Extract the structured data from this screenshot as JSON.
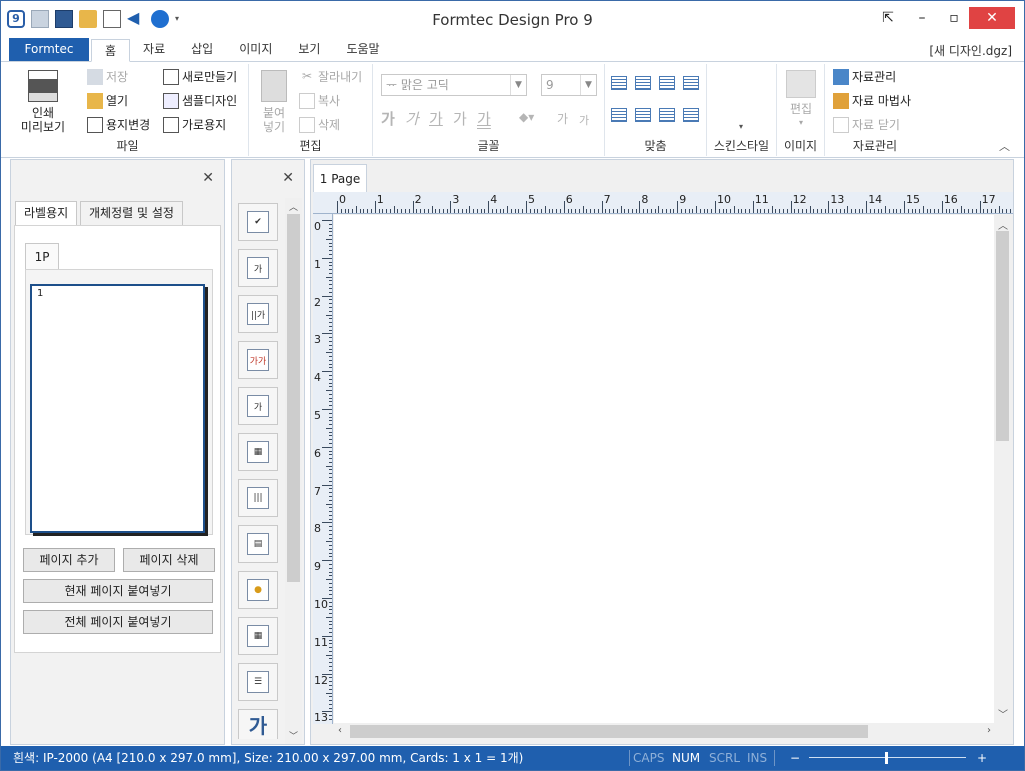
{
  "app": {
    "title": "Formtec Design Pro 9",
    "filename": "[새 디자인.dgz]"
  },
  "tabs": {
    "formtec": "Formtec",
    "items": [
      "홈",
      "자료",
      "삽입",
      "이미지",
      "보기",
      "도움말"
    ]
  },
  "ribbon": {
    "file": {
      "label": "파일",
      "print_preview": "인쇄\n미리보기",
      "save": "저장",
      "open": "열기",
      "paper_change": "용지변경",
      "new": "새로만들기",
      "sample_design": "샘플디자인",
      "landscape": "가로용지"
    },
    "edit": {
      "label": "편집",
      "paste": "붙여\n넣기",
      "cut": "잘라내기",
      "copy": "복사",
      "delete": "삭제"
    },
    "font": {
      "label": "글꼴",
      "font_name": "맑은 고딕",
      "font_size": "9"
    },
    "align": {
      "label": "맞춤"
    },
    "skin": {
      "label": "스킨스타일"
    },
    "image": {
      "label": "이미지",
      "edit": "편집"
    },
    "data": {
      "label": "자료관리",
      "manage": "자료관리",
      "wizard": "자료 마법사",
      "close": "자료 닫기"
    }
  },
  "left_panel": {
    "tabs": [
      "라벨용지",
      "개체정렬 및 설정"
    ],
    "page_tab": "1P",
    "thumb_number": "1",
    "add_page": "페이지 추가",
    "delete_page": "페이지 삭제",
    "paste_current": "현재 페이지 붙여넣기",
    "paste_all": "전체 페이지 붙여넣기"
  },
  "document": {
    "tab": "1 Page",
    "h_ruler": [
      "0",
      "1",
      "2",
      "3",
      "4",
      "5",
      "6",
      "7",
      "8",
      "9",
      "10",
      "11",
      "12",
      "13",
      "14",
      "15",
      "16",
      "17"
    ],
    "v_ruler": [
      "0",
      "1",
      "2",
      "3",
      "4",
      "5",
      "6",
      "7",
      "8",
      "9",
      "10",
      "11",
      "12",
      "13"
    ]
  },
  "status": {
    "info": "흰색: IP-2000 (A4 [210.0 x 297.0 mm], Size: 210.00 x 297.00 mm,  Cards: 1 x 1 = 1개)",
    "caps": "CAPS",
    "num": "NUM",
    "scrl": "SCRL",
    "ins": "INS",
    "zoom_minus": "−",
    "zoom_plus": "+"
  },
  "colors": {
    "accent": "#1f5fae",
    "close": "#e04343"
  }
}
